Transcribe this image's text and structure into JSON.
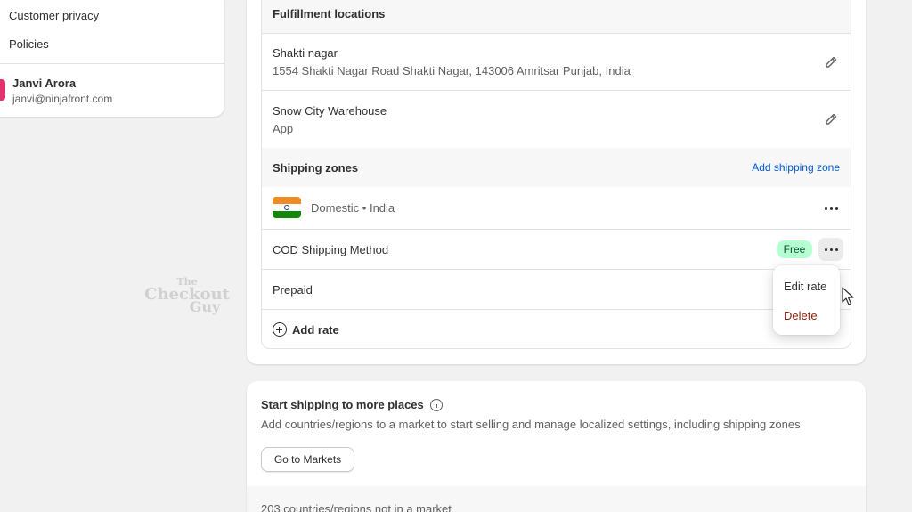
{
  "sidebar": {
    "links": [
      "Customer privacy",
      "Policies"
    ],
    "user": {
      "name": "Janvi Arora",
      "email": "janvi@ninjafront.com"
    }
  },
  "watermark": {
    "line1": "The",
    "line2": "Checkout",
    "line3": "Guy"
  },
  "fulfillment": {
    "title": "Fulfillment locations",
    "locations": [
      {
        "name": "Shakti nagar",
        "detail": "1554 Shakti Nagar Road Shakti Nagar, 143006 Amritsar Punjab, India",
        "icon": "pencil-icon"
      },
      {
        "name": "Snow City Warehouse",
        "detail": "App",
        "icon": "pencil-icon"
      }
    ]
  },
  "shipping_zones": {
    "title": "Shipping zones",
    "add_zone_label": "Add shipping zone",
    "zone": {
      "name": "Domestic • India",
      "flag": "india-flag-icon"
    },
    "rates": [
      {
        "name": "COD Shipping Method",
        "badge": "Free"
      },
      {
        "name": "Prepaid"
      }
    ],
    "add_rate_label": "Add rate"
  },
  "rate_menu": {
    "items": [
      "Edit rate",
      "Delete"
    ],
    "delete_color": "#8e1f0b"
  },
  "start_shipping": {
    "title": "Start shipping to more places",
    "description": "Add countries/regions to a market to start selling and manage localized settings, including shipping zones",
    "button_label": "Go to Markets",
    "footer": "203 countries/regions not in a market"
  },
  "colors": {
    "accent": "#005bd3",
    "badge_bg": "#b4fed2",
    "avatar": "#e5316e"
  }
}
